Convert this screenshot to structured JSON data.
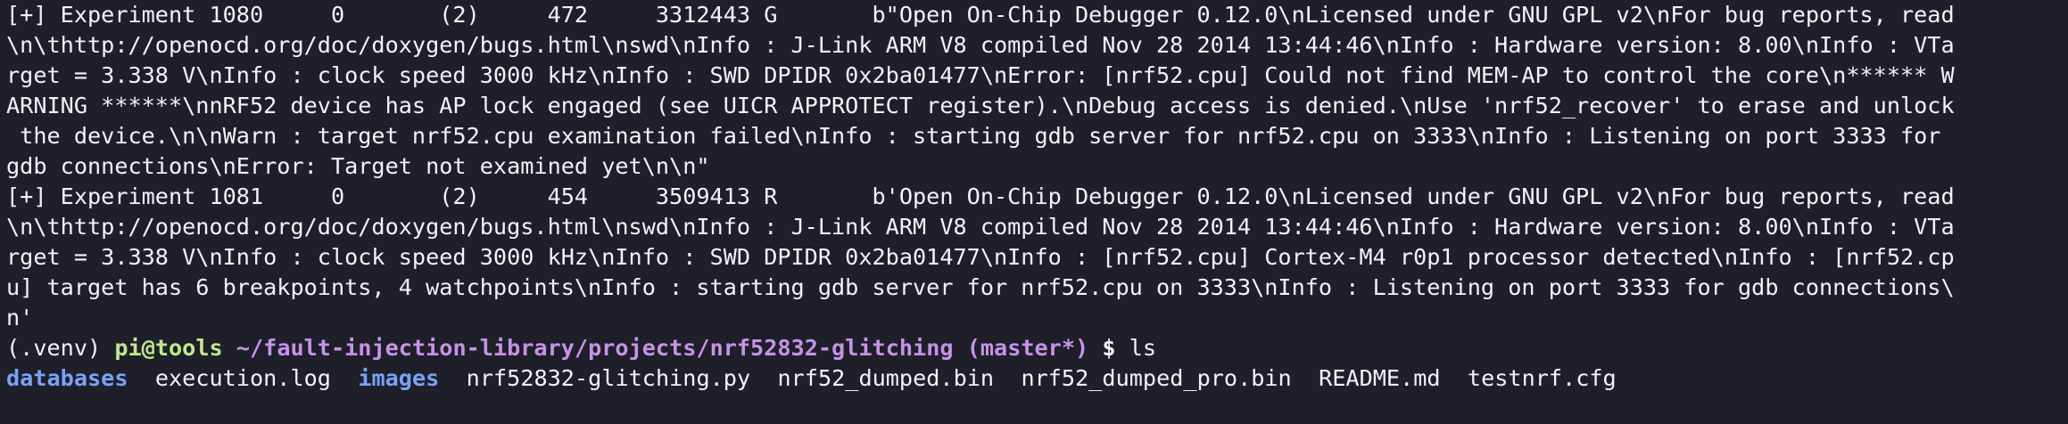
{
  "theme": {
    "background": "#1e1f29",
    "foreground": "#f1f3f5",
    "accent_dir": "#7aa2f7",
    "accent_path": "#c792ea",
    "accent_user": "#c3e88d"
  },
  "output": {
    "exp1080": [
      "[+] Experiment 1080     0       (2)     472     3312443 G       b\"Open On-Chip Debugger 0.12.0\\nLicensed under GNU GPL v2\\nFor bug reports, read",
      "\\n\\thttp://openocd.org/doc/doxygen/bugs.html\\nswd\\nInfo : J-Link ARM V8 compiled Nov 28 2014 13:44:46\\nInfo : Hardware version: 8.00\\nInfo : VTa",
      "rget = 3.338 V\\nInfo : clock speed 3000 kHz\\nInfo : SWD DPIDR 0x2ba01477\\nError: [nrf52.cpu] Could not find MEM-AP to control the core\\n****** W",
      "ARNING ******\\nnRF52 device has AP lock engaged (see UICR APPROTECT register).\\nDebug access is denied.\\nUse 'nrf52_recover' to erase and unlock",
      " the device.\\n\\nWarn : target nrf52.cpu examination failed\\nInfo : starting gdb server for nrf52.cpu on 3333\\nInfo : Listening on port 3333 for",
      "gdb connections\\nError: Target not examined yet\\n\\n\""
    ],
    "exp1081": [
      "[+] Experiment 1081     0       (2)     454     3509413 R       b'Open On-Chip Debugger 0.12.0\\nLicensed under GNU GPL v2\\nFor bug reports, read",
      "\\n\\thttp://openocd.org/doc/doxygen/bugs.html\\nswd\\nInfo : J-Link ARM V8 compiled Nov 28 2014 13:44:46\\nInfo : Hardware version: 8.00\\nInfo : VTa",
      "rget = 3.338 V\\nInfo : clock speed 3000 kHz\\nInfo : SWD DPIDR 0x2ba01477\\nInfo : [nrf52.cpu] Cortex-M4 r0p1 processor detected\\nInfo : [nrf52.cp",
      "u] target has 6 breakpoints, 4 watchpoints\\nInfo : starting gdb server for nrf52.cpu on 3333\\nInfo : Listening on port 3333 for gdb connections\\",
      "n'"
    ]
  },
  "prompt": {
    "venv": "(.venv) ",
    "user_host": "pi@tools",
    "cwd": " ~/fault-injection-library/projects/nrf52832-glitching",
    "branch": " (master*)",
    "symbol": " $ ",
    "command": "ls"
  },
  "listing": {
    "databases": "databases",
    "execution_log": "execution.log",
    "images": "images",
    "script": "nrf52832-glitching.py",
    "dumped_bin": "nrf52_dumped.bin",
    "dumped_pro_bin": "nrf52_dumped_pro.bin",
    "readme": "README.md",
    "cfg": "testnrf.cfg"
  }
}
